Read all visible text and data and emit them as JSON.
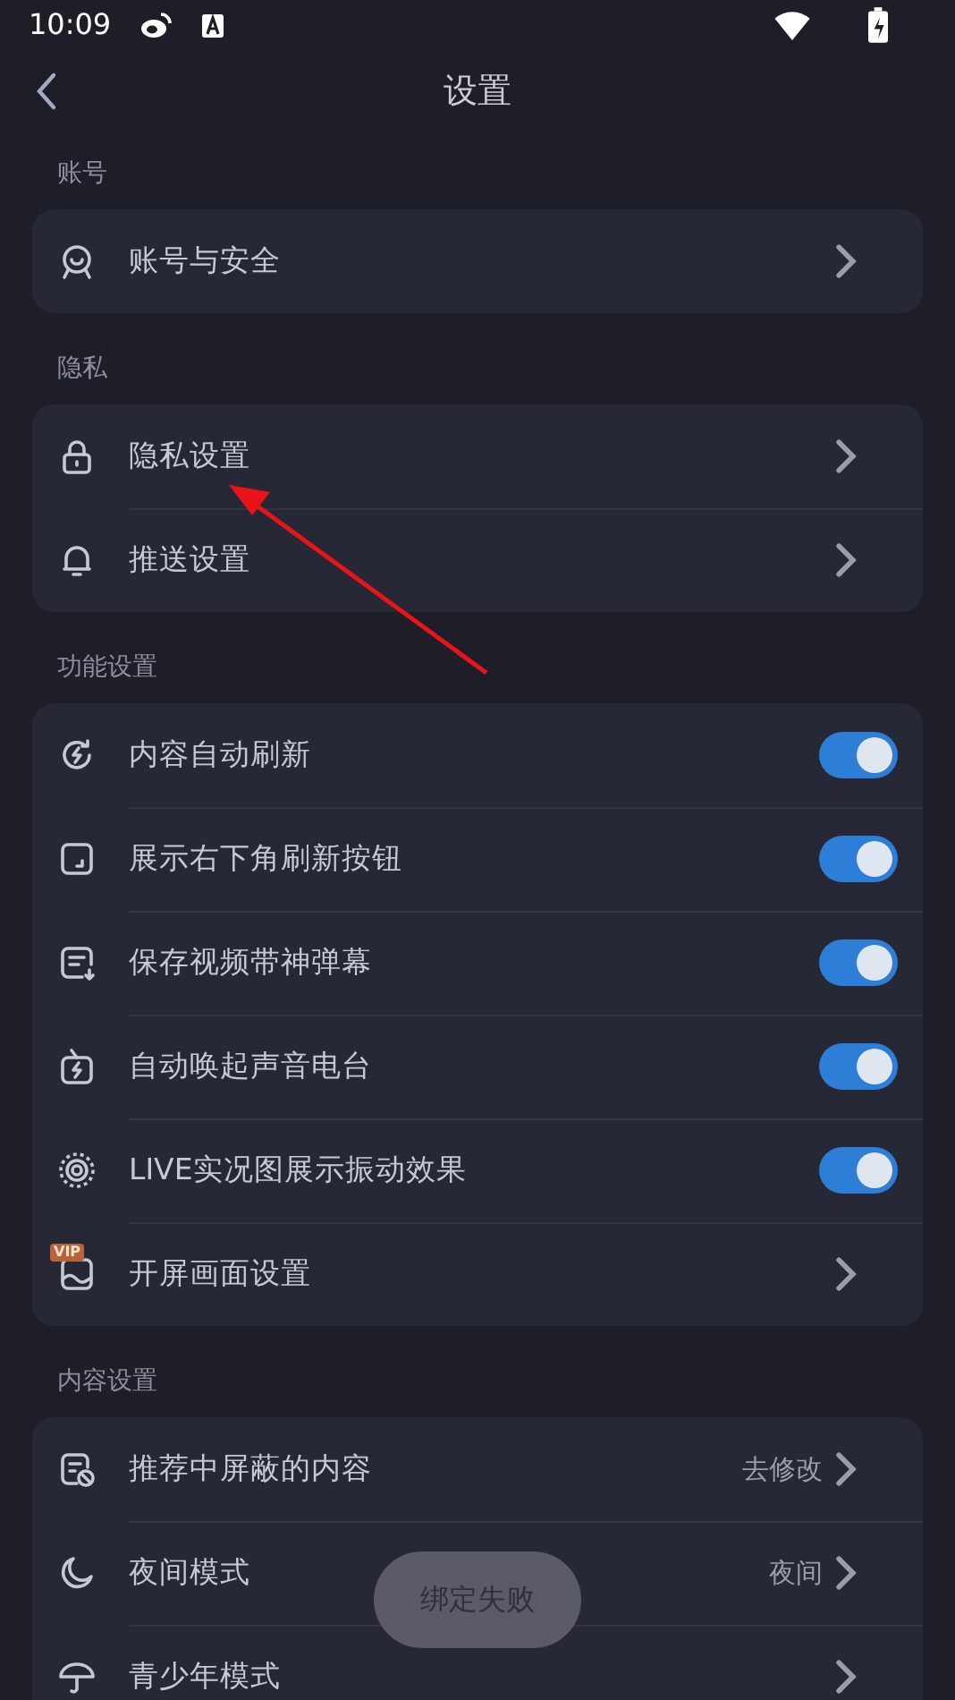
{
  "status_bar": {
    "time": "10:09"
  },
  "header": {
    "title": "设置"
  },
  "sections": [
    {
      "label": "账号",
      "rows": [
        {
          "kind": "link",
          "label": "账号与安全"
        }
      ]
    },
    {
      "label": "隐私",
      "rows": [
        {
          "kind": "link",
          "label": "隐私设置"
        },
        {
          "kind": "link",
          "label": "推送设置"
        }
      ]
    },
    {
      "label": "功能设置",
      "rows": [
        {
          "kind": "toggle",
          "label": "内容自动刷新",
          "on": true
        },
        {
          "kind": "toggle",
          "label": "展示右下角刷新按钮",
          "on": true
        },
        {
          "kind": "toggle",
          "label": "保存视频带神弹幕",
          "on": true
        },
        {
          "kind": "toggle",
          "label": "自动唤起声音电台",
          "on": true
        },
        {
          "kind": "toggle",
          "label": "LIVE实况图展示振动效果",
          "on": true
        },
        {
          "kind": "link",
          "label": "开屏画面设置",
          "badge": "VIP"
        }
      ]
    },
    {
      "label": "内容设置",
      "rows": [
        {
          "kind": "value",
          "label": "推荐中屏蔽的内容",
          "value": "去修改"
        },
        {
          "kind": "value",
          "label": "夜间模式",
          "value": "夜间"
        },
        {
          "kind": "link",
          "label": "青少年模式"
        }
      ]
    }
  ],
  "toast": {
    "text": "绑定失败"
  }
}
